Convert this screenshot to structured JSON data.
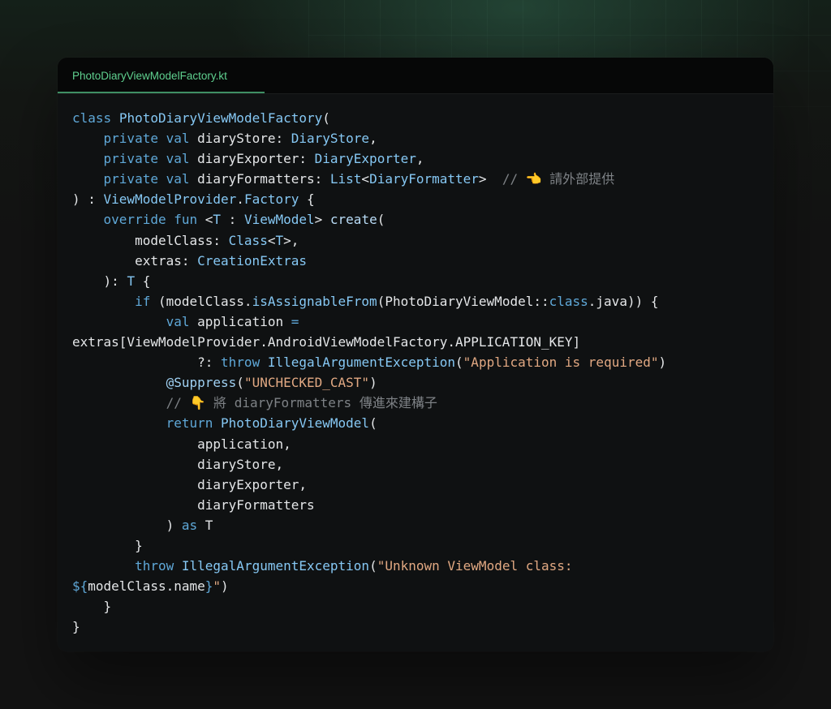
{
  "tab": {
    "label": "PhotoDiaryViewModelFactory.kt"
  },
  "code": {
    "language": "kotlin",
    "colors": {
      "keyword": "#5fa8d8",
      "type": "#86c8f4",
      "function": "#b9dcf7",
      "string": "#e1a882",
      "comment": "#7e8286",
      "plain": "#e4e6e8",
      "tab_accent": "#5fd08f"
    },
    "lines": [
      [
        [
          "kw",
          "class"
        ],
        [
          "pl",
          " "
        ],
        [
          "ty",
          "PhotoDiaryViewModelFactory"
        ],
        [
          "pl",
          "("
        ]
      ],
      [
        [
          "pl",
          "    "
        ],
        [
          "kw",
          "private val"
        ],
        [
          "pl",
          " diaryStore: "
        ],
        [
          "ty",
          "DiaryStore"
        ],
        [
          "pl",
          ","
        ]
      ],
      [
        [
          "pl",
          "    "
        ],
        [
          "kw",
          "private val"
        ],
        [
          "pl",
          " diaryExporter: "
        ],
        [
          "ty",
          "DiaryExporter"
        ],
        [
          "pl",
          ","
        ]
      ],
      [
        [
          "pl",
          "    "
        ],
        [
          "kw",
          "private val"
        ],
        [
          "pl",
          " diaryFormatters: "
        ],
        [
          "ty",
          "List"
        ],
        [
          "pl",
          "<"
        ],
        [
          "ty",
          "DiaryFormatter"
        ],
        [
          "pl",
          ">  "
        ],
        [
          "cm",
          "// "
        ],
        [
          "em",
          "👈"
        ],
        [
          "cm",
          " 請外部提供"
        ]
      ],
      [
        [
          "pl",
          ") : "
        ],
        [
          "ty",
          "ViewModelProvider"
        ],
        [
          "pl",
          "."
        ],
        [
          "ty",
          "Factory"
        ],
        [
          "pl",
          " {"
        ]
      ],
      [
        [
          "pl",
          "    "
        ],
        [
          "kw",
          "override fun"
        ],
        [
          "pl",
          " <"
        ],
        [
          "ty",
          "T"
        ],
        [
          "pl",
          " : "
        ],
        [
          "ty",
          "ViewModel"
        ],
        [
          "pl",
          "> "
        ],
        [
          "fn",
          "create"
        ],
        [
          "pl",
          "("
        ]
      ],
      [
        [
          "pl",
          "        modelClass: "
        ],
        [
          "ty",
          "Class"
        ],
        [
          "pl",
          "<"
        ],
        [
          "ty",
          "T"
        ],
        [
          "pl",
          ">,"
        ]
      ],
      [
        [
          "pl",
          "        extras: "
        ],
        [
          "ty",
          "CreationExtras"
        ]
      ],
      [
        [
          "pl",
          "    ): "
        ],
        [
          "ty",
          "T"
        ],
        [
          "pl",
          " {"
        ]
      ],
      [
        [
          "pl",
          "        "
        ],
        [
          "kw",
          "if"
        ],
        [
          "pl",
          " (modelClass."
        ],
        [
          "ty",
          "isAssignableFrom"
        ],
        [
          "pl",
          "(PhotoDiaryViewModel::"
        ],
        [
          "kw",
          "class"
        ],
        [
          "pl",
          ".java)) {"
        ]
      ],
      [
        [
          "pl",
          "            "
        ],
        [
          "kw",
          "val"
        ],
        [
          "pl",
          " application "
        ],
        [
          "kw",
          "="
        ]
      ],
      [
        [
          "pl",
          "extras[ViewModelProvider.AndroidViewModelFactory.APPLICATION_KEY]"
        ]
      ],
      [
        [
          "pl",
          "                ?: "
        ],
        [
          "kw",
          "throw"
        ],
        [
          "pl",
          " "
        ],
        [
          "ty",
          "IllegalArgumentException"
        ],
        [
          "pl",
          "("
        ],
        [
          "str",
          "\"Application is required\""
        ],
        [
          "pl",
          ")"
        ]
      ],
      [
        [
          "pl",
          "            "
        ],
        [
          "an",
          "@Suppress"
        ],
        [
          "pl",
          "("
        ],
        [
          "str",
          "\"UNCHECKED_CAST\""
        ],
        [
          "pl",
          ")"
        ]
      ],
      [
        [
          "pl",
          "            "
        ],
        [
          "cm",
          "// "
        ],
        [
          "em",
          "👇"
        ],
        [
          "cm",
          " 將 diaryFormatters 傳進來建構子"
        ]
      ],
      [
        [
          "pl",
          "            "
        ],
        [
          "kw",
          "return"
        ],
        [
          "pl",
          " "
        ],
        [
          "ty",
          "PhotoDiaryViewModel"
        ],
        [
          "pl",
          "("
        ]
      ],
      [
        [
          "pl",
          "                application,"
        ]
      ],
      [
        [
          "pl",
          "                diaryStore,"
        ]
      ],
      [
        [
          "pl",
          "                diaryExporter,"
        ]
      ],
      [
        [
          "pl",
          "                diaryFormatters"
        ]
      ],
      [
        [
          "pl",
          "            ) "
        ],
        [
          "kw",
          "as"
        ],
        [
          "pl",
          " T"
        ]
      ],
      [
        [
          "pl",
          "        }"
        ]
      ],
      [
        [
          "pl",
          "        "
        ],
        [
          "kw",
          "throw"
        ],
        [
          "pl",
          " "
        ],
        [
          "ty",
          "IllegalArgumentException"
        ],
        [
          "pl",
          "("
        ],
        [
          "str",
          "\"Unknown ViewModel class:"
        ]
      ],
      [
        [
          "kw",
          "${"
        ],
        [
          "pl",
          "modelClass.name"
        ],
        [
          "kw",
          "}"
        ],
        [
          "str",
          "\""
        ],
        [
          "pl",
          ")"
        ]
      ],
      [
        [
          "pl",
          "    }"
        ]
      ],
      [
        [
          "pl",
          "}"
        ]
      ]
    ]
  }
}
